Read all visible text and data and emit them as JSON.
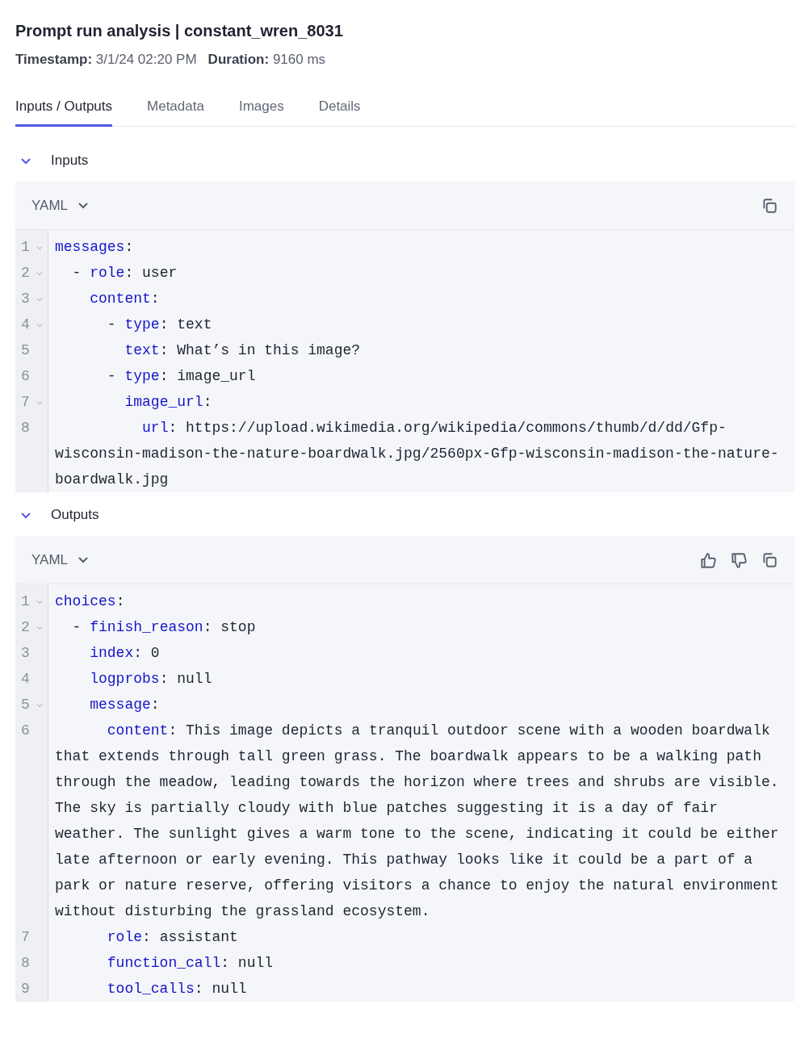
{
  "header": {
    "title": "Prompt run analysis",
    "subtitle": "| constant_wren_8031"
  },
  "meta": [
    {
      "label": "Timestamp:",
      "value": "3/1/24 02:20 PM"
    },
    {
      "label": "Duration:",
      "value": "9160 ms"
    }
  ],
  "tabs": [
    {
      "label": "Inputs / Outputs",
      "selected": true
    },
    {
      "label": "Metadata",
      "selected": false
    },
    {
      "label": "Images",
      "selected": false
    },
    {
      "label": "Details",
      "selected": false
    }
  ],
  "sections": [
    {
      "title": "Inputs",
      "expanded": true,
      "format": "YAML",
      "actions": [
        {
          "kind": "copy"
        }
      ],
      "lines": [
        {
          "number": "1",
          "foldable": true,
          "key": "messages",
          "rest": ":",
          "children": [
            {
              "number": "2",
              "foldable": true,
              "dash": "-",
              "key": "role",
              "rest": ": user",
              "children": [
                {
                  "number": "3",
                  "foldable": true,
                  "key": "content",
                  "rest": ":",
                  "children": [
                    {
                      "number": "4",
                      "foldable": true,
                      "dash": "-",
                      "key": "type",
                      "rest": ": text",
                      "children": [
                        {
                          "number": "5",
                          "foldable": false,
                          "key": "text",
                          "rest": ": What’s in this image?"
                        }
                      ]
                    },
                    {
                      "number": "6",
                      "foldable": false,
                      "dash": "-",
                      "key": "type",
                      "rest": ": image_url",
                      "children": [
                        {
                          "number": "7",
                          "foldable": true,
                          "key": "image_url",
                          "rest": ":",
                          "children": [
                            {
                              "number": "8",
                              "foldable": false,
                              "key": "url",
                              "rest": ": https://upload.wikimedia.org/wikipedia/commons/thumb/d/dd/Gfp-wisconsin-madison-the-nature-boardwalk.jpg/2560px-Gfp-wisconsin-madison-the-nature-boardwalk.jpg"
                            }
                          ]
                        }
                      ]
                    }
                  ]
                }
              ]
            }
          ]
        }
      ]
    },
    {
      "title": "Outputs",
      "expanded": true,
      "format": "YAML",
      "actions": [
        {
          "kind": "thumbs_up"
        },
        {
          "kind": "thumbs_down"
        },
        {
          "kind": "copy"
        }
      ],
      "lines": [
        {
          "number": "1",
          "foldable": true,
          "key": "choices",
          "rest": ":",
          "children": [
            {
              "number": "2",
              "foldable": true,
              "dash": "-",
              "key": "finish_reason",
              "rest": ": stop",
              "children": [
                {
                  "number": "3",
                  "foldable": false,
                  "key": "index",
                  "rest": ": 0"
                },
                {
                  "number": "4",
                  "foldable": false,
                  "key": "logprobs",
                  "rest": ": null"
                },
                {
                  "number": "5",
                  "foldable": true,
                  "key": "message",
                  "rest": ":",
                  "children": [
                    {
                      "number": "6",
                      "foldable": false,
                      "key": "content",
                      "rest": ": This image depicts a tranquil outdoor scene with a wooden boardwalk that extends through tall green grass. The boardwalk appears to be a walking path through the meadow, leading towards the horizon where trees and shrubs are visible. The sky is partially cloudy with blue patches suggesting it is a day of fair weather. The sunlight gives a warm tone to the scene, indicating it could be either late afternoon or early evening. This pathway looks like it could be a part of a park or nature reserve, offering visitors a chance to enjoy the natural environment without disturbing the grassland ecosystem."
                    },
                    {
                      "number": "7",
                      "foldable": false,
                      "key": "role",
                      "rest": ": assistant"
                    },
                    {
                      "number": "8",
                      "foldable": false,
                      "key": "function_call",
                      "rest": ": null"
                    },
                    {
                      "number": "9",
                      "foldable": false,
                      "key": "tool_calls",
                      "rest": ": null"
                    }
                  ]
                }
              ]
            }
          ]
        }
      ]
    }
  ]
}
